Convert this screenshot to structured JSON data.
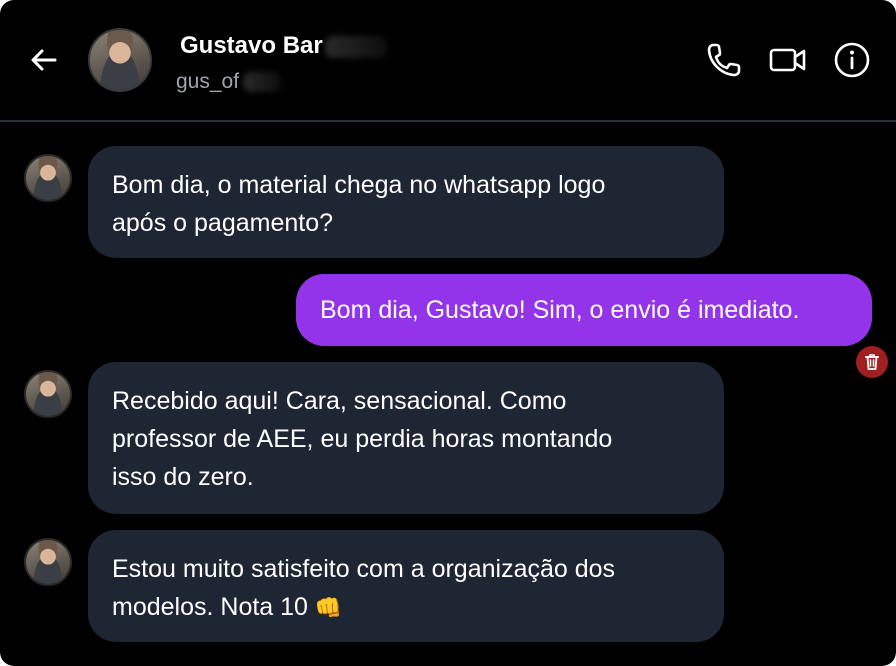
{
  "header": {
    "back_icon": "arrow-left-icon",
    "contact_name": "Gustavo Bar",
    "contact_username": "gus_of",
    "actions": [
      {
        "icon": "phone-icon"
      },
      {
        "icon": "video-camera-icon"
      },
      {
        "icon": "info-icon"
      }
    ]
  },
  "messages": [
    {
      "direction": "incoming",
      "text_lines": [
        "Bom dia, o material chega no whatsapp logo",
        "após o pagamento?"
      ]
    },
    {
      "direction": "outgoing",
      "text_lines": [
        "Bom dia, Gustavo! Sim, o envio é imediato."
      ],
      "action_icon": "trash-icon"
    },
    {
      "direction": "incoming",
      "text_lines": [
        "Recebido aqui! Cara, sensacional. Como",
        "professor de AEE, eu perdia horas montando",
        "isso do zero."
      ]
    },
    {
      "direction": "incoming",
      "text_lines": [
        "Estou muito satisfeito com a organização dos",
        "modelos. Nota 10"
      ],
      "emoji": "👊"
    }
  ],
  "colors": {
    "background": "#000000",
    "incoming_bubble": "#1f2633",
    "outgoing_bubble": "#9333ea",
    "delete_button": "#a01f1f",
    "username_text": "#a0a4ab"
  }
}
